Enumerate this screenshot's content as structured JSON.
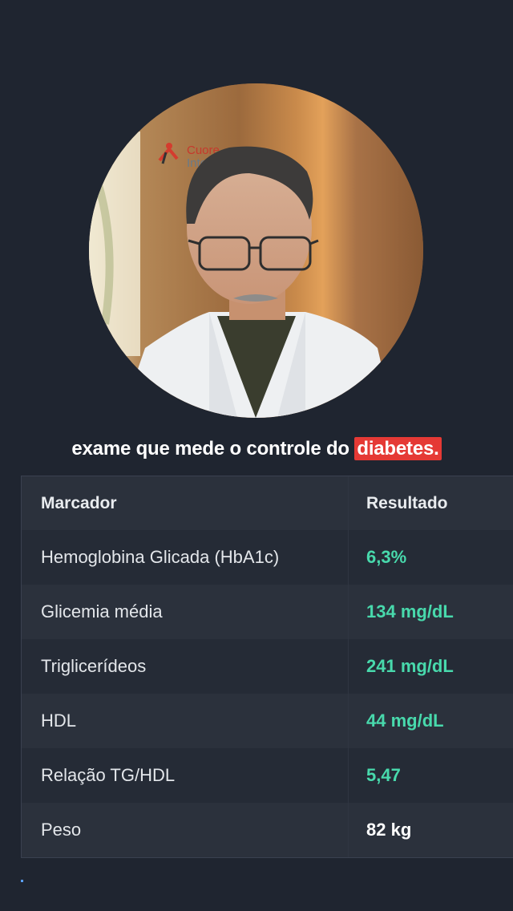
{
  "caption": {
    "text": "exame que mede o controle do ",
    "highlight": "diabetes."
  },
  "logo": {
    "line1": "Cuore",
    "line2": "Inte"
  },
  "table": {
    "headers": [
      "Marcador",
      "Resultado"
    ],
    "rows": [
      {
        "marker": "Hemoglobina Glicada (HbA1c)",
        "result": "6,3%"
      },
      {
        "marker": "Glicemia média",
        "result": "134 mg/dL"
      },
      {
        "marker": "Triglicerídeos",
        "result": "241 mg/dL"
      },
      {
        "marker": "HDL",
        "result": "44 mg/dL"
      },
      {
        "marker": "Relação TG/HDL",
        "result": "5,47"
      },
      {
        "marker": "Peso",
        "result": "82 kg"
      }
    ]
  },
  "colors": {
    "background": "#1f2530",
    "highlight": "#e53935",
    "result_green": "#48d9ac"
  }
}
